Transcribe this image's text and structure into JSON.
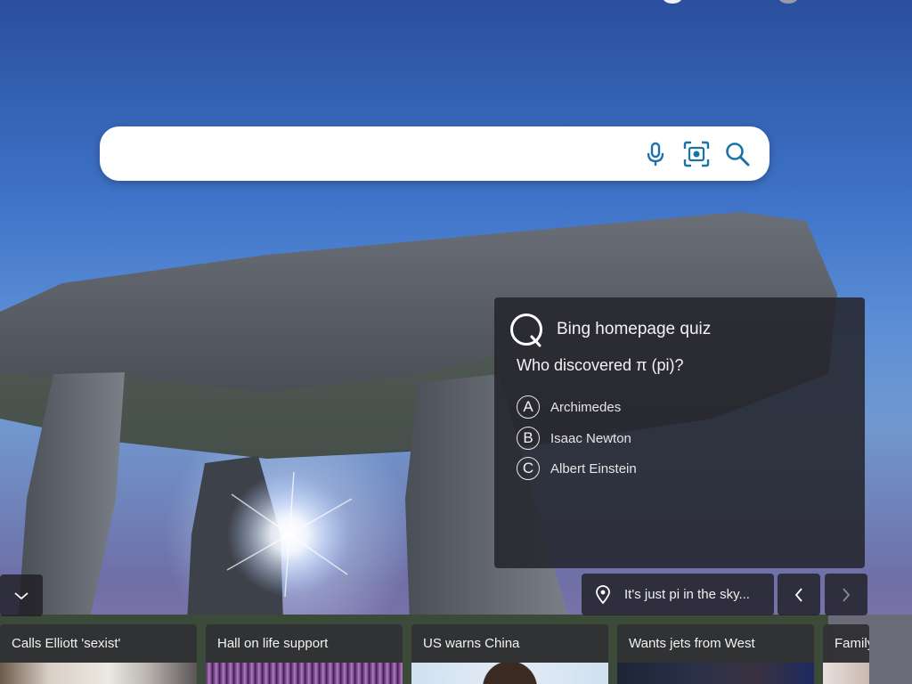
{
  "search": {
    "value": "",
    "placeholder": ""
  },
  "icons": {
    "voice": "microphone-icon",
    "visual_search": "camera-scan-icon",
    "search": "search-icon",
    "quiz": "quiz-logo-icon",
    "location": "location-pin-icon",
    "collapse": "chevron-down-icon",
    "prev": "chevron-left-icon",
    "next": "chevron-right-icon"
  },
  "quiz": {
    "title": "Bing homepage quiz",
    "question": "Who discovered π (pi)?",
    "options": [
      {
        "letter": "A",
        "text": "Archimedes"
      },
      {
        "letter": "B",
        "text": "Isaac Newton"
      },
      {
        "letter": "C",
        "text": "Albert Einstein"
      }
    ]
  },
  "image_info": {
    "text": "It's just pi in the sky..."
  },
  "news": [
    {
      "headline": "Calls Elliott 'sexist'"
    },
    {
      "headline": "Hall on life support"
    },
    {
      "headline": "US warns China"
    },
    {
      "headline": "Wants jets from West"
    },
    {
      "headline": "Family"
    }
  ],
  "colors": {
    "accent": "#1a73a8",
    "panel": "#26262c"
  }
}
